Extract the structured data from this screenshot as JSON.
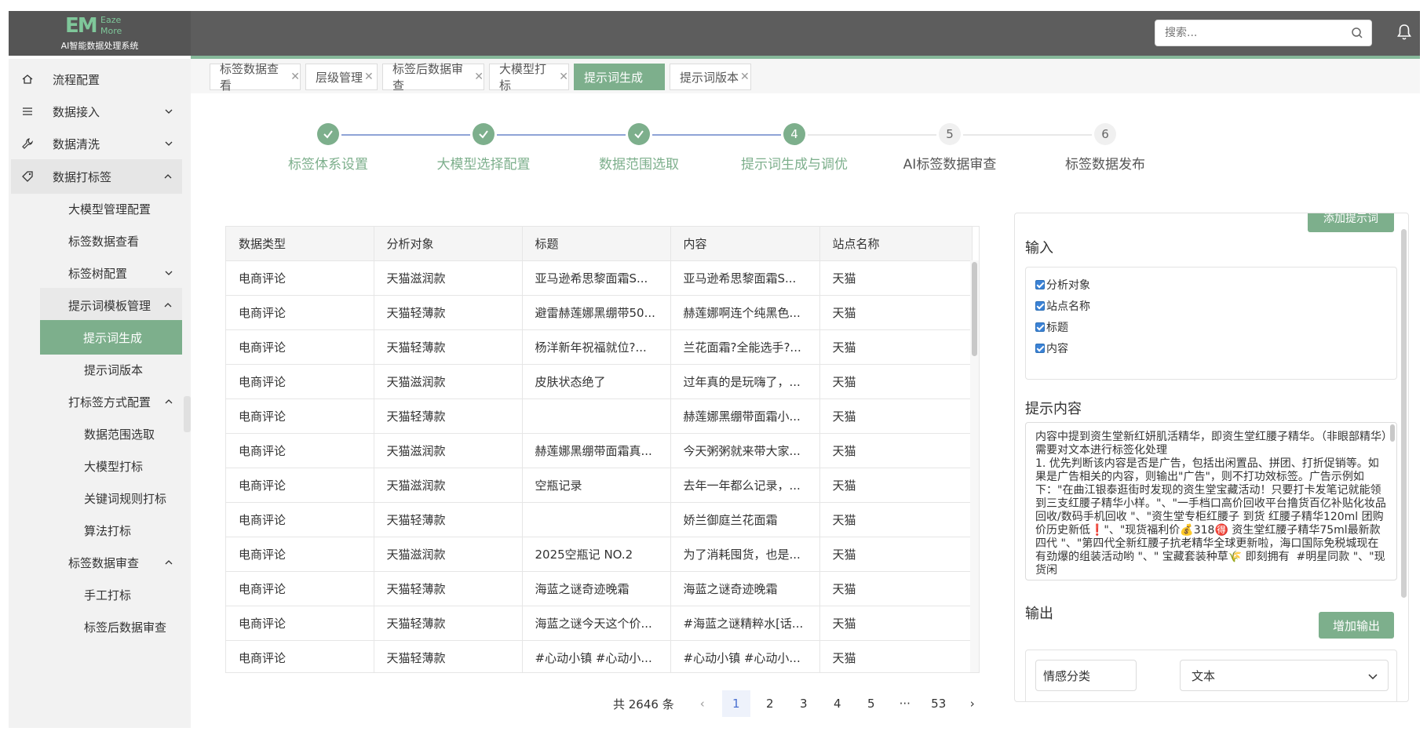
{
  "app": {
    "logo_mark": "EM",
    "logo_sub": "Eaze More",
    "system_name": "AI智能数据处理系统"
  },
  "search": {
    "placeholder": "搜索..."
  },
  "sidebar": {
    "items": [
      {
        "label": "流程配置",
        "icon": "home-icon"
      },
      {
        "label": "数据接入",
        "icon": "list-icon"
      },
      {
        "label": "数据清洗",
        "icon": "wrench-icon"
      },
      {
        "label": "数据打标签",
        "icon": "tag-icon"
      },
      {
        "label": "大模型管理配置"
      },
      {
        "label": "标签数据查看"
      },
      {
        "label": "标签树配置"
      },
      {
        "label": "提示词模板管理"
      },
      {
        "label": "提示词生成"
      },
      {
        "label": "提示词版本"
      },
      {
        "label": "打标签方式配置"
      },
      {
        "label": "数据范围选取"
      },
      {
        "label": "大模型打标"
      },
      {
        "label": "关键词规则打标"
      },
      {
        "label": "算法打标"
      },
      {
        "label": "标签数据审查"
      },
      {
        "label": "手工打标"
      },
      {
        "label": "标签后数据审查"
      }
    ]
  },
  "tabs": [
    {
      "label": "标签数据查看",
      "active": false
    },
    {
      "label": "层级管理",
      "active": false
    },
    {
      "label": "标签后数据审查",
      "active": false
    },
    {
      "label": "大模型打标",
      "active": false
    },
    {
      "label": "提示词生成",
      "active": true
    },
    {
      "label": "提示词版本",
      "active": false
    }
  ],
  "steps": [
    {
      "label": "标签体系设置",
      "state": "done",
      "num": ""
    },
    {
      "label": "大模型选择配置",
      "state": "done",
      "num": ""
    },
    {
      "label": "数据范围选取",
      "state": "done",
      "num": ""
    },
    {
      "label": "提示词生成与调优",
      "state": "current",
      "num": "4"
    },
    {
      "label": "AI标签数据审查",
      "state": "todo",
      "num": "5"
    },
    {
      "label": "标签数据发布",
      "state": "todo",
      "num": "6"
    }
  ],
  "table": {
    "columns": [
      "数据类型",
      "分析对象",
      "标题",
      "内容",
      "站点名称"
    ],
    "rows": [
      [
        "电商评论",
        "天猫滋润款",
        "亚马逊希思黎面霜S...",
        "亚马逊希思黎面霜S...",
        "天猫"
      ],
      [
        "电商评论",
        "天猫轻薄款",
        "避雷赫莲娜黑绷带50...",
        "赫莲娜啊连个纯黑色...",
        "天猫"
      ],
      [
        "电商评论",
        "天猫轻薄款",
        "杨洋新年祝福就位?...",
        "兰花面霜?全能选手?...",
        "天猫"
      ],
      [
        "电商评论",
        "天猫滋润款",
        "皮肤状态绝了",
        "过年真的是玩嗨了，...",
        "天猫"
      ],
      [
        "电商评论",
        "天猫轻薄款",
        "",
        "赫莲娜黑绷带面霜小...",
        "天猫"
      ],
      [
        "电商评论",
        "天猫滋润款",
        "赫莲娜黑绷带面霜真...",
        "今天粥粥就来带大家...",
        "天猫"
      ],
      [
        "电商评论",
        "天猫滋润款",
        "空瓶记录",
        "去年一年都么记录，...",
        "天猫"
      ],
      [
        "电商评论",
        "天猫轻薄款",
        "",
        "娇兰御庭兰花面霜",
        "天猫"
      ],
      [
        "电商评论",
        "天猫滋润款",
        "2025空瓶记 NO.2",
        "为了消耗囤货，也是...",
        "天猫"
      ],
      [
        "电商评论",
        "天猫轻薄款",
        "海蓝之谜奇迹晚霜",
        "海蓝之谜奇迹晚霜",
        "天猫"
      ],
      [
        "电商评论",
        "天猫轻薄款",
        "海蓝之谜今天这个价...",
        "#海蓝之谜精粹水[话...",
        "天猫"
      ],
      [
        "电商评论",
        "天猫轻薄款",
        "#心动小镇 #心动小...",
        "#心动小镇 #心动小...",
        "天猫"
      ]
    ]
  },
  "pagination": {
    "total": "共 2646 条",
    "prev": "‹",
    "pages": [
      "1",
      "2",
      "3",
      "4",
      "5",
      "···",
      "53"
    ],
    "next": "›",
    "current": "1"
  },
  "panel": {
    "top_button": "添加提示词",
    "input_title": "输入",
    "checkboxes": [
      "分析对象",
      "站点名称",
      "标题",
      "内容"
    ],
    "prompt_title": "提示内容",
    "prompt_text": "内容中提到资生堂新红妍肌活精华，即资生堂红腰子精华。（非眼部精华）需要对文本进行标签化处理\n1. 优先判断该内容是否是广告，包括出闲置品、拼团、打折促销等。如果是广告相关的内容，则输出\"广告\"，则不打功效标签。广告示例如下：\"在曲江银泰逛街时发现的资生堂宝藏活动！只要打卡发笔记就能领到三支红腰子精华小样。\"、\"一手档口高价回收平台撸货百亿补贴化妆品回收/数码手机回收 \"、\"资生堂专柜红腰子 到货 红腰子精华120ml 团购价历史新低❗\"、\"现货福利价💰318🉐 资生堂红腰子精华75ml最新款四代 \"、\"第四代全新红腰子抗老精华全球更新啦，海口国际免税城现在有劲爆的组装活动哟 \"、\" 宝藏套装种草🌾 即刻拥有  #明星同款 \"、\"现货闲",
    "output_title": "输出",
    "add_output_button": "增加输出",
    "output_name": "情感分类",
    "output_type": "文本"
  }
}
